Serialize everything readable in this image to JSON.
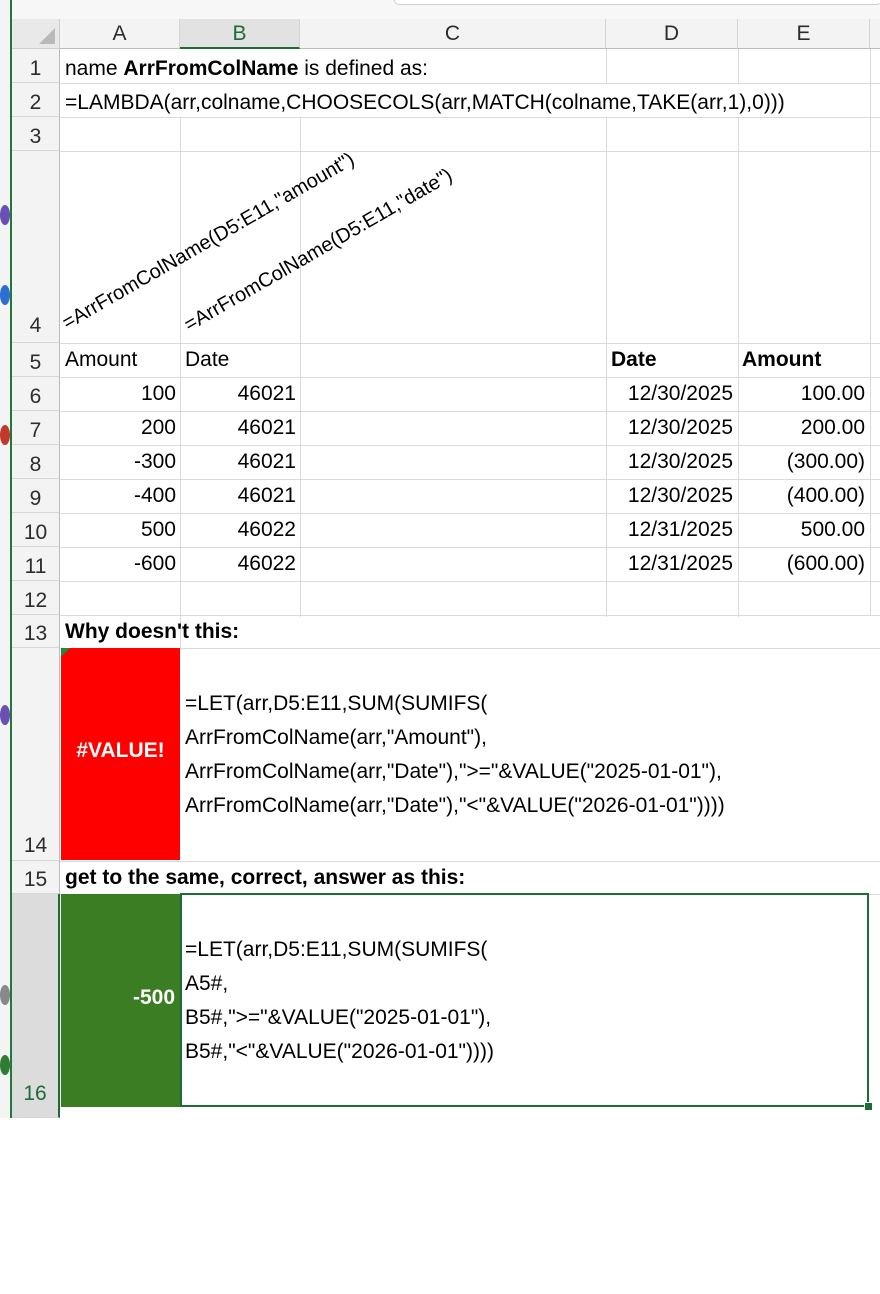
{
  "columns": [
    "A",
    "B",
    "C",
    "D",
    "E"
  ],
  "rows": [
    "1",
    "2",
    "3",
    "4",
    "5",
    "6",
    "7",
    "8",
    "9",
    "10",
    "11",
    "12",
    "13",
    "14",
    "15",
    "16"
  ],
  "cells": {
    "a1_prefix": "name ",
    "a1_name": "ArrFromColName",
    "a1_suffix": " is defined as:",
    "a2": "=LAMBDA(arr,colname,CHOOSECOLS(arr,MATCH(colname,TAKE(arr,1),0)))",
    "a4_rotated": "=ArrFromColName(D5:E11,\"amount\")",
    "b4_rotated": "=ArrFromColName(D5:E11,\"date\")",
    "a5": "Amount",
    "b5": "Date",
    "d5": "Date",
    "e5": "Amount",
    "a13": "Why doesn't this:",
    "a14": "#VALUE!",
    "a15": "get to the same, correct, answer as this:",
    "a16": "-500"
  },
  "table_rows": [
    {
      "amount": "100",
      "serial": "46021",
      "date": "12/30/2025",
      "formatted": "100.00"
    },
    {
      "amount": "200",
      "serial": "46021",
      "date": "12/30/2025",
      "formatted": "200.00"
    },
    {
      "amount": "-300",
      "serial": "46021",
      "date": "12/30/2025",
      "formatted": "(300.00)"
    },
    {
      "amount": "-400",
      "serial": "46021",
      "date": "12/30/2025",
      "formatted": "(400.00)"
    },
    {
      "amount": "500",
      "serial": "46022",
      "date": "12/31/2025",
      "formatted": "500.00"
    },
    {
      "amount": "-600",
      "serial": "46022",
      "date": "12/31/2025",
      "formatted": "(600.00)"
    }
  ],
  "formula_b14": [
    "=LET(arr,D5:E11,SUM(SUMIFS(",
    "ArrFromColName(arr,\"Amount\"),",
    "ArrFromColName(arr,\"Date\"),\">=\"&VALUE(\"2025-01-01\"),",
    "ArrFromColName(arr,\"Date\"),\"<\"&VALUE(\"2026-01-01\"))))"
  ],
  "formula_b16": [
    "=LET(arr,D5:E11,SUM(SUMIFS(",
    "A5#,",
    "B5#,\">=\"&VALUE(\"2025-01-01\"),",
    "B5#,\"<\"&VALUE(\"2026-01-01\"))))"
  ],
  "colors": {
    "error_fill": "#ff0000",
    "result_fill": "#3b7d23",
    "selection": "#1d6b38"
  }
}
